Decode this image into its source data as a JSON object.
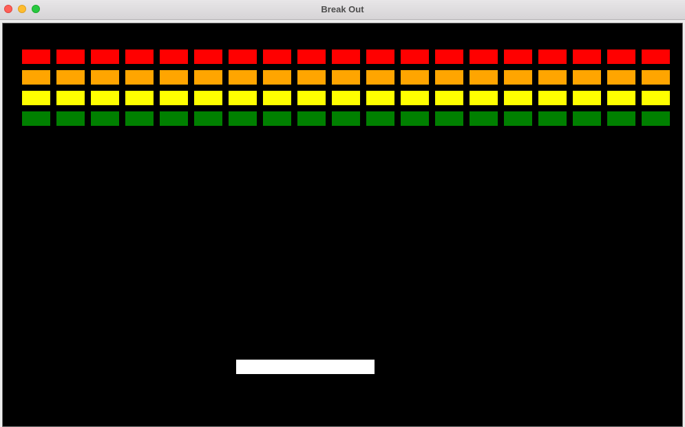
{
  "window": {
    "title": "Break Out"
  },
  "game": {
    "background_color": "#000000",
    "paddle_color": "#ffffff",
    "bricks_per_row": 19,
    "rows": [
      {
        "name": "red",
        "color": "#ff0000"
      },
      {
        "name": "orange",
        "color": "#ffa500"
      },
      {
        "name": "yellow",
        "color": "#ffff00"
      },
      {
        "name": "green",
        "color": "#008000"
      }
    ]
  }
}
